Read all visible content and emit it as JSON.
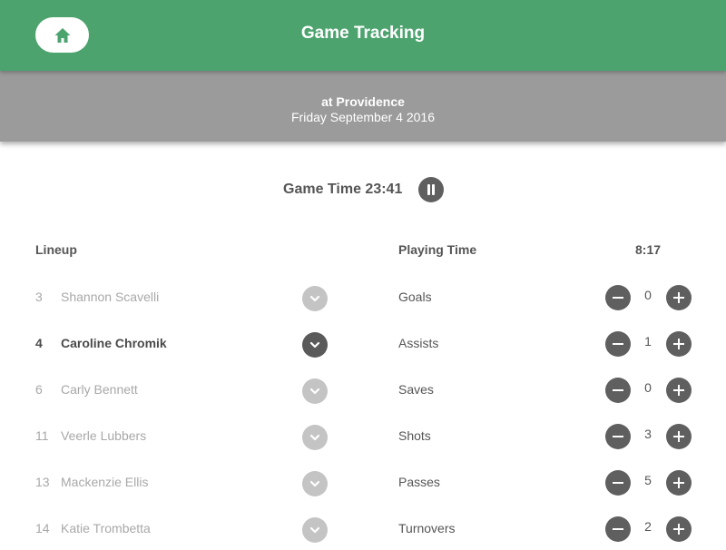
{
  "header": {
    "title": "Game Tracking",
    "home_icon": "home-icon",
    "accent": "#4ca36e"
  },
  "game": {
    "opponent": "at Providence",
    "date": "Friday September 4 2016",
    "time_label": "Game Time 23:41",
    "pause_icon": "pause-icon"
  },
  "lineup": {
    "heading": "Lineup",
    "players": [
      {
        "number": "3",
        "name": "Shannon Scavelli",
        "active": false
      },
      {
        "number": "4",
        "name": "Caroline Chromik",
        "active": true
      },
      {
        "number": "6",
        "name": "Carly Bennett",
        "active": false
      },
      {
        "number": "11",
        "name": "Veerle Lubbers",
        "active": false
      },
      {
        "number": "13",
        "name": "Mackenzie Ellis",
        "active": false
      },
      {
        "number": "14",
        "name": "Katie Trombetta",
        "active": false
      }
    ]
  },
  "stats": {
    "heading": "Playing Time",
    "playing_time": "8:17",
    "items": [
      {
        "name": "Goals",
        "count": "0"
      },
      {
        "name": "Assists",
        "count": "1"
      },
      {
        "name": "Saves",
        "count": "0"
      },
      {
        "name": "Shots",
        "count": "3"
      },
      {
        "name": "Passes",
        "count": "5"
      },
      {
        "name": "Turnovers",
        "count": "2"
      }
    ]
  }
}
